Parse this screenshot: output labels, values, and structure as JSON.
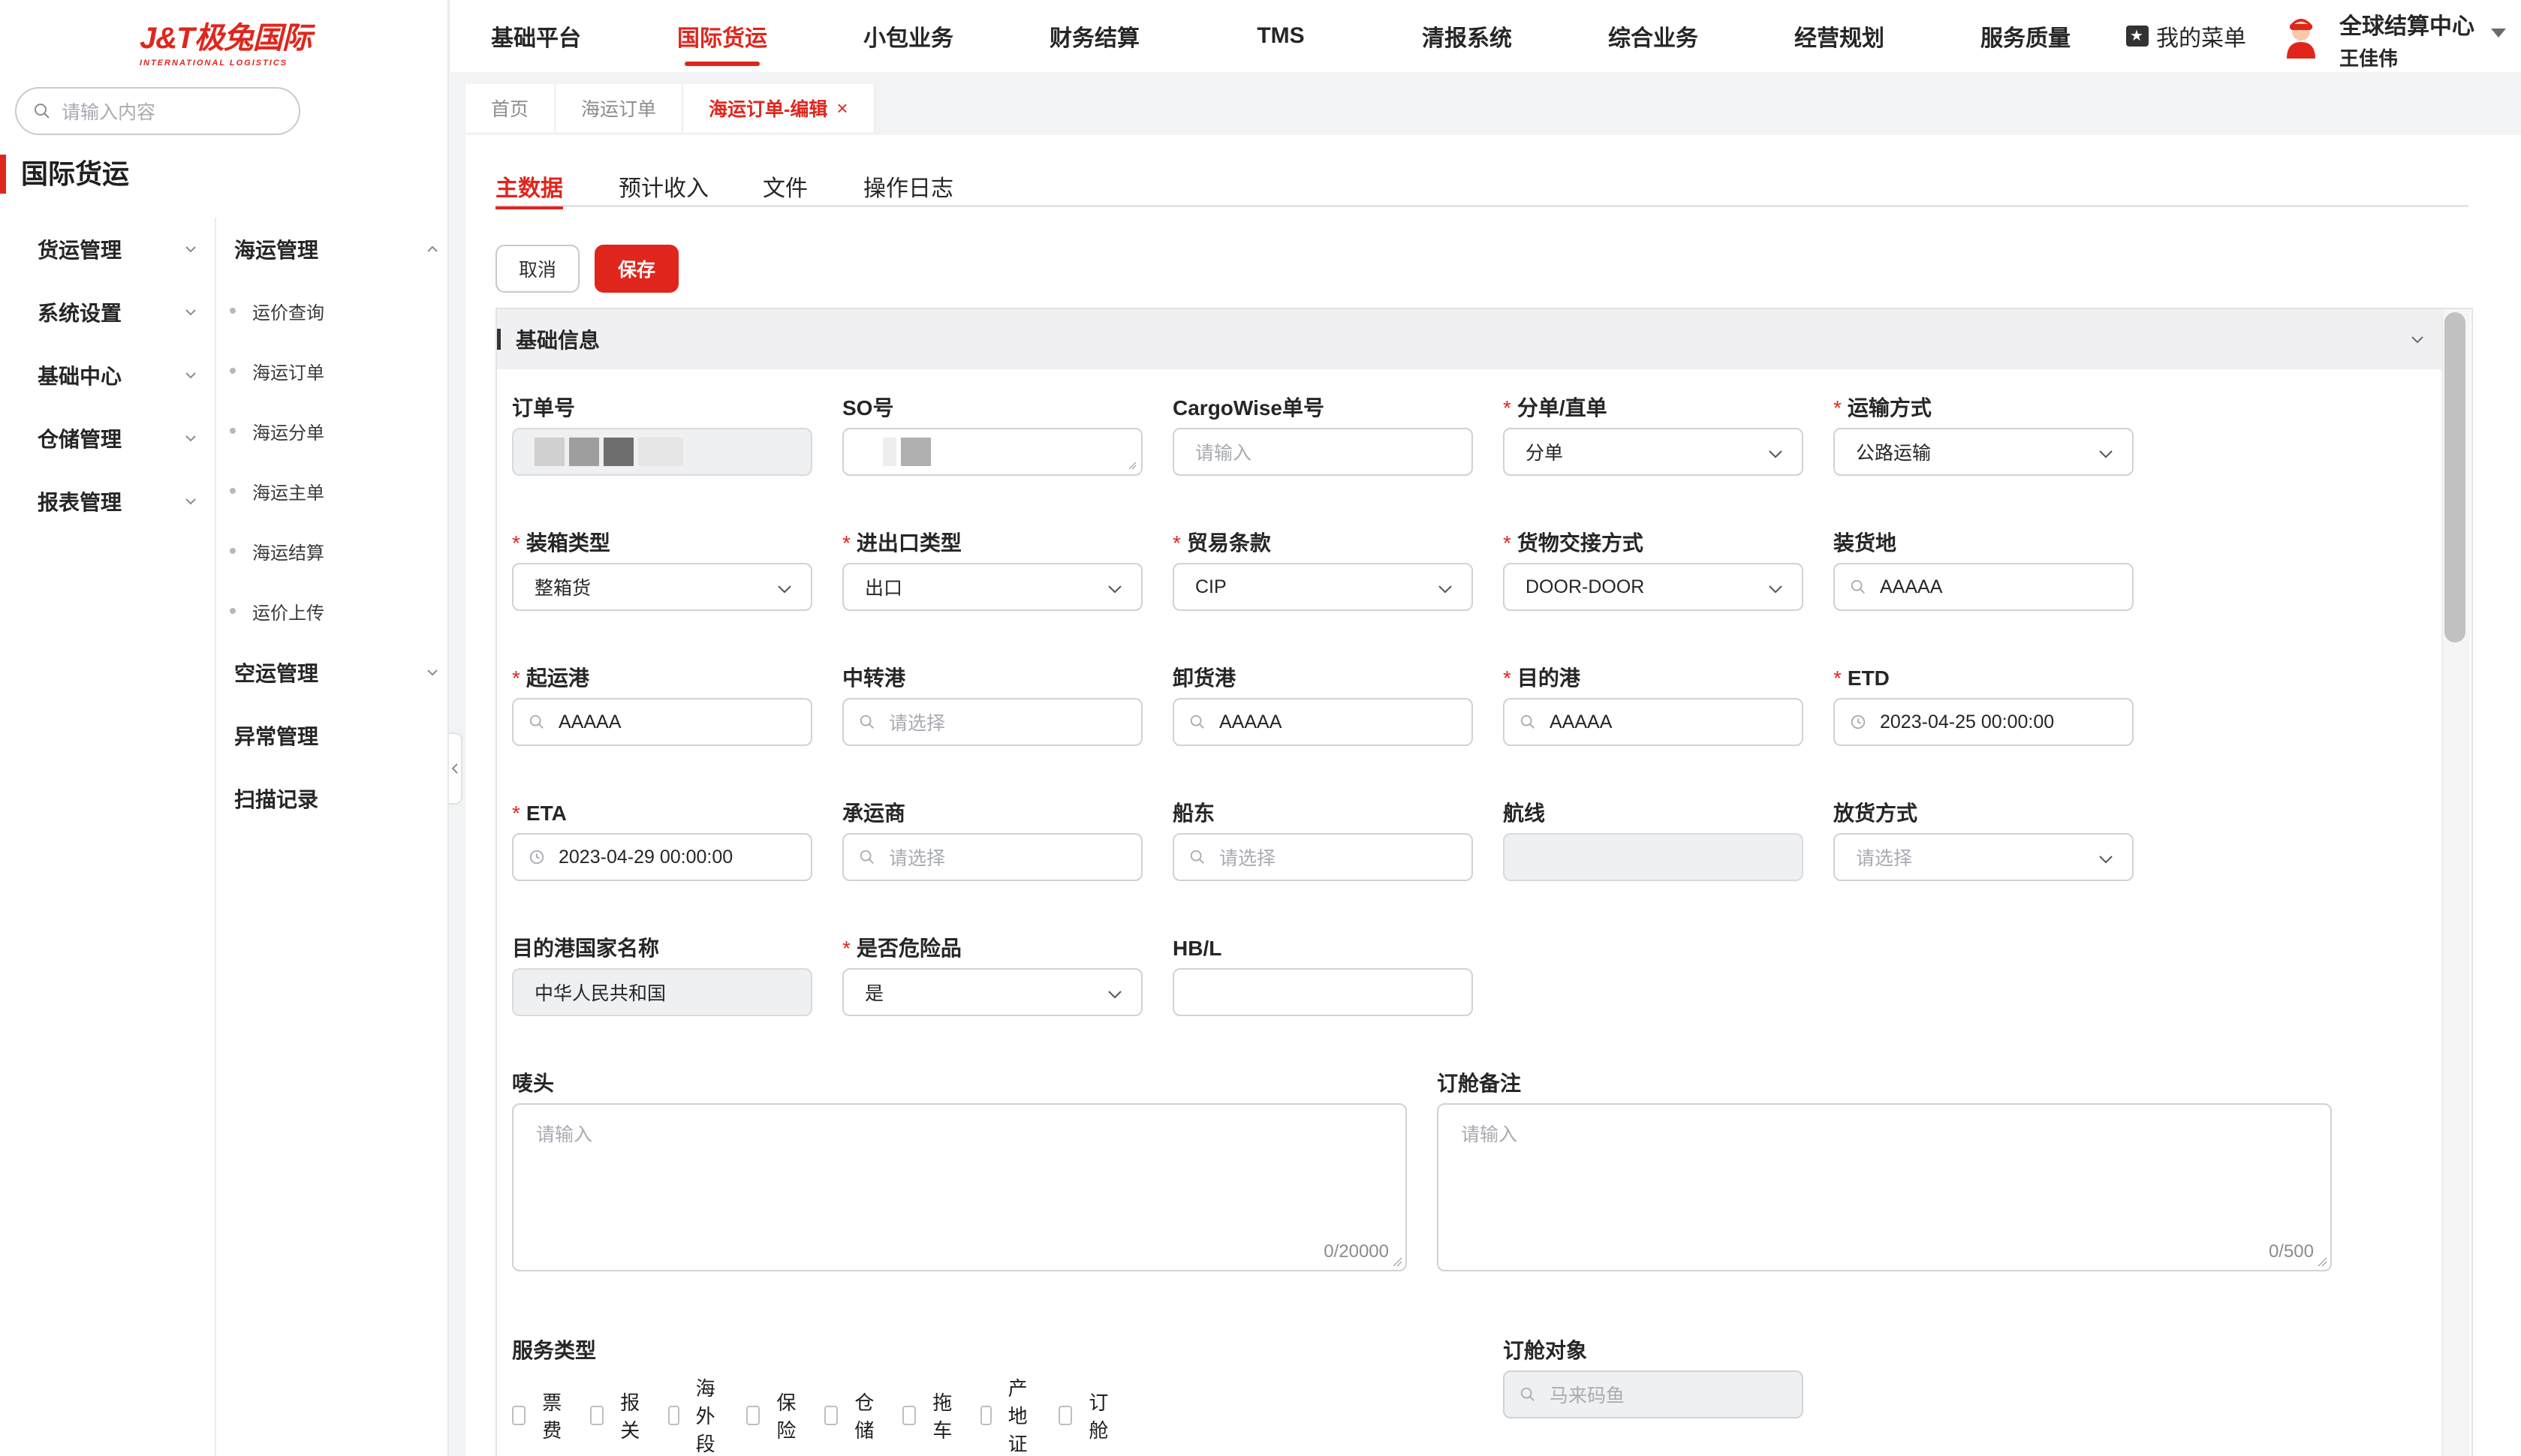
{
  "brand": {
    "logo_text": "J&T极兔国际",
    "logo_sub": "INTERNATIONAL LOGISTICS"
  },
  "sidebar": {
    "search_placeholder": "请输入内容",
    "module_title": "国际货运",
    "col1": [
      {
        "label": "货运管理"
      },
      {
        "label": "系统设置"
      },
      {
        "label": "基础中心"
      },
      {
        "label": "仓储管理"
      },
      {
        "label": "报表管理"
      }
    ],
    "col2": {
      "group_sea": "海运管理",
      "sea_items": [
        "运价查询",
        "海运订单",
        "海运分单",
        "海运主单",
        "海运结算",
        "运价上传"
      ],
      "group_air": "空运管理",
      "group_exception": "异常管理",
      "group_scan": "扫描记录"
    }
  },
  "topnav": {
    "items": [
      "基础平台",
      "国际货运",
      "小包业务",
      "财务结算",
      "TMS",
      "清报系统",
      "综合业务",
      "经营规划",
      "服务质量"
    ],
    "active": "国际货运",
    "my_menu": "我的菜单",
    "user_org": "全球结算中心",
    "user_name": "王佳伟"
  },
  "page_tabs": [
    {
      "label": "首页"
    },
    {
      "label": "海运订单"
    },
    {
      "label": "海运订单-编辑",
      "active": true
    }
  ],
  "sub_tabs": [
    "主数据",
    "预计收入",
    "文件",
    "操作日志"
  ],
  "buttons": {
    "cancel": "取消",
    "save": "保存"
  },
  "section": {
    "title": "基础信息"
  },
  "form": {
    "order_no": {
      "label": "订单号",
      "value": ""
    },
    "so_no": {
      "label": "SO号",
      "value": ""
    },
    "cargowise_no": {
      "label": "CargoWise单号",
      "placeholder": "请输入"
    },
    "split_type": {
      "label": "分单/直单",
      "value": "分单",
      "required": true
    },
    "transport_mode": {
      "label": "运输方式",
      "value": "公路运输",
      "required": true
    },
    "packing_type": {
      "label": "装箱类型",
      "value": "整箱货",
      "required": true
    },
    "import_export": {
      "label": "进出口类型",
      "value": "出口",
      "required": true
    },
    "trade_terms": {
      "label": "贸易条款",
      "value": "CIP",
      "required": true
    },
    "handover_mode": {
      "label": "货物交接方式",
      "value": "DOOR-DOOR",
      "required": true
    },
    "loading_place": {
      "label": "装货地",
      "value": "AAAAA"
    },
    "origin_port": {
      "label": "起运港",
      "value": "AAAAA",
      "required": true
    },
    "transit_port": {
      "label": "中转港",
      "placeholder": "请选择"
    },
    "discharge_port": {
      "label": "卸货港",
      "value": "AAAAA"
    },
    "dest_port": {
      "label": "目的港",
      "value": "AAAAA",
      "required": true
    },
    "etd": {
      "label": "ETD",
      "value": "2023-04-25 00:00:00",
      "required": true
    },
    "eta": {
      "label": "ETA",
      "value": "2023-04-29 00:00:00",
      "required": true
    },
    "carrier": {
      "label": "承运商",
      "placeholder": "请选择"
    },
    "shipowner": {
      "label": "船东",
      "placeholder": "请选择"
    },
    "route": {
      "label": "航线",
      "value": ""
    },
    "release_mode": {
      "label": "放货方式",
      "placeholder": "请选择"
    },
    "dest_country": {
      "label": "目的港国家名称",
      "value": "中华人民共和国"
    },
    "dangerous": {
      "label": "是否危险品",
      "value": "是",
      "required": true
    },
    "hbl": {
      "label": "HB/L",
      "value": ""
    },
    "shipping_mark": {
      "label": "唛头",
      "placeholder": "请输入",
      "counter": "0/20000"
    },
    "booking_remark": {
      "label": "订舱备注",
      "placeholder": "请输入",
      "counter": "0/500"
    },
    "service_type": {
      "label": "服务类型",
      "options": [
        "票费",
        "报关",
        "海外段",
        "保险",
        "仓储",
        "拖车",
        "产地证",
        "订舱"
      ]
    },
    "booking_target": {
      "label": "订舱对象",
      "placeholder": "马来码鱼"
    }
  },
  "colors": {
    "brand_red": "#e0261c"
  }
}
